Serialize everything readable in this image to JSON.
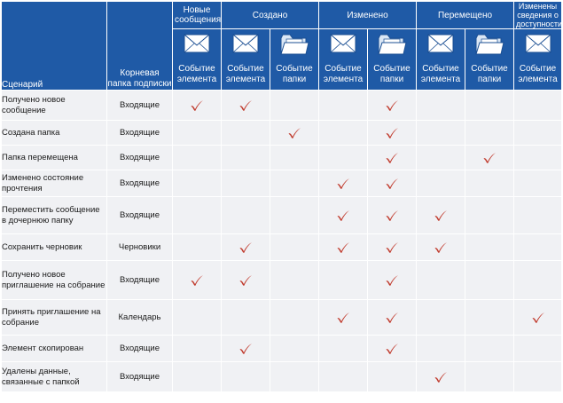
{
  "header": {
    "scenario_label": "Сценарий",
    "root_label": "Корневая папка подписки",
    "groups": [
      {
        "key": "new",
        "label": "Новые сообщения"
      },
      {
        "key": "created",
        "label": "Создано"
      },
      {
        "key": "modified",
        "label": "Изменено"
      },
      {
        "key": "moved",
        "label": "Перемещено"
      },
      {
        "key": "freebusy",
        "label": "Изменены сведения о доступности"
      }
    ],
    "columns": [
      {
        "group": "new",
        "icon": "envelope-icon",
        "label": "Событие элемента"
      },
      {
        "group": "created",
        "icon": "envelope-icon",
        "label": "Событие элемента"
      },
      {
        "group": "created",
        "icon": "folder-icon",
        "label": "Событие папки"
      },
      {
        "group": "modified",
        "icon": "envelope-icon",
        "label": "Событие элемента"
      },
      {
        "group": "modified",
        "icon": "folder-icon",
        "label": "Событие папки"
      },
      {
        "group": "moved",
        "icon": "envelope-icon",
        "label": "Событие элемента"
      },
      {
        "group": "moved",
        "icon": "folder-icon",
        "label": "Событие папки"
      },
      {
        "group": "freebusy",
        "icon": "envelope-icon",
        "label": "Событие элемента"
      }
    ]
  },
  "rows": [
    {
      "scenario": "Получено новое сообщение",
      "folder": "Входящие",
      "checks": [
        true,
        true,
        false,
        false,
        true,
        false,
        false,
        false
      ]
    },
    {
      "scenario": "Создана папка",
      "folder": "Входящие",
      "checks": [
        false,
        false,
        true,
        false,
        true,
        false,
        false,
        false
      ]
    },
    {
      "scenario": "Папка перемещена",
      "folder": "Входящие",
      "checks": [
        false,
        false,
        false,
        false,
        true,
        false,
        true,
        false
      ]
    },
    {
      "scenario": "Изменено состояние прочтения",
      "folder": "Входящие",
      "checks": [
        false,
        false,
        false,
        true,
        true,
        false,
        false,
        false
      ]
    },
    {
      "scenario": "Переместить сообщение в дочернюю папку",
      "folder": "Входящие",
      "checks": [
        false,
        false,
        false,
        true,
        true,
        true,
        false,
        false
      ]
    },
    {
      "scenario": "Сохранить черновик",
      "folder": "Черновики",
      "checks": [
        false,
        true,
        false,
        true,
        true,
        true,
        false,
        false
      ]
    },
    {
      "scenario": "Получено новое приглашение на собрание",
      "folder": "Входящие",
      "checks": [
        true,
        true,
        false,
        false,
        true,
        false,
        false,
        false
      ]
    },
    {
      "scenario": "Принять приглашение на собрание",
      "folder": "Календарь",
      "checks": [
        false,
        false,
        false,
        true,
        true,
        false,
        false,
        true
      ]
    },
    {
      "scenario": "Элемент скопирован",
      "folder": "Входящие",
      "checks": [
        false,
        true,
        false,
        false,
        true,
        false,
        false,
        false
      ]
    },
    {
      "scenario": "Удалены данные, связанные с папкой",
      "folder": "Входящие",
      "checks": [
        false,
        false,
        false,
        false,
        false,
        true,
        false,
        false
      ]
    }
  ],
  "colors": {
    "header": "#1f5aa6",
    "cell": "#f0f1f4",
    "check": "#c0392b"
  }
}
